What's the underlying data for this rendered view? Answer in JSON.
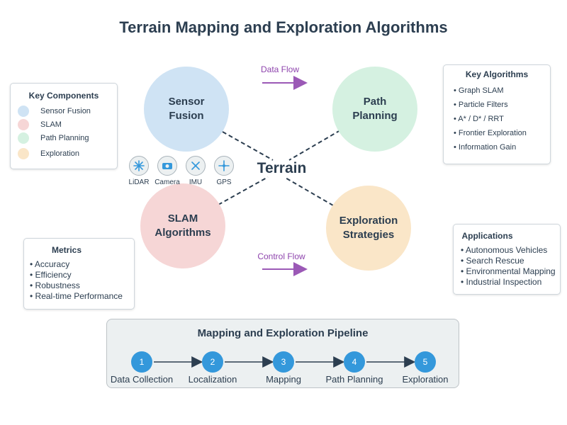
{
  "title": "Terrain Mapping and Exploration Algorithms",
  "center_label": "Terrain",
  "nodes": {
    "sensor_fusion": {
      "line1": "Sensor",
      "line2": "Fusion",
      "color": "#cfe3f4"
    },
    "path_planning": {
      "line1": "Path",
      "line2": "Planning",
      "color": "#d5f1e1"
    },
    "slam": {
      "line1": "SLAM",
      "line2": "Algorithms",
      "color": "#f6d6d6"
    },
    "exploration": {
      "line1": "Exploration",
      "line2": "Strategies",
      "color": "#fae6c8"
    }
  },
  "flows": {
    "data_flow": "Data Flow",
    "control_flow": "Control Flow",
    "arrow_color": "#9b59b6"
  },
  "sensors": [
    {
      "label": "LiDAR",
      "icon": "lidar-icon"
    },
    {
      "label": "Camera",
      "icon": "camera-icon"
    },
    {
      "label": "IMU",
      "icon": "imu-icon"
    },
    {
      "label": "GPS",
      "icon": "gps-icon"
    }
  ],
  "key_components": {
    "title": "Key Components",
    "items": [
      {
        "label": "Sensor Fusion",
        "color": "#cfe3f4"
      },
      {
        "label": "SLAM",
        "color": "#f6d6d6"
      },
      {
        "label": "Path Planning",
        "color": "#d5f1e1"
      },
      {
        "label": "Exploration",
        "color": "#fae6c8"
      }
    ]
  },
  "key_algorithms": {
    "title": "Key Algorithms",
    "items": [
      "• Graph SLAM",
      "• Particle Filters",
      "• A* / D* / RRT",
      "• Frontier Exploration",
      "• Information Gain"
    ]
  },
  "applications": {
    "title": "Applications",
    "items": [
      "• Autonomous Vehicles",
      "• Search Rescue",
      "• Environmental Mapping",
      "• Industrial Inspection"
    ]
  },
  "metrics": {
    "title": "Metrics",
    "items": [
      "• Accuracy",
      "• Efficiency",
      "• Robustness",
      "• Real-time Performance"
    ]
  },
  "pipeline": {
    "title": "Mapping and Exploration Pipeline",
    "steps": [
      {
        "num": "1",
        "label": "Data Collection"
      },
      {
        "num": "2",
        "label": "Localization"
      },
      {
        "num": "3",
        "label": "Mapping"
      },
      {
        "num": "4",
        "label": "Path Planning"
      },
      {
        "num": "5",
        "label": "Exploration"
      }
    ],
    "step_color": "#3498db"
  }
}
